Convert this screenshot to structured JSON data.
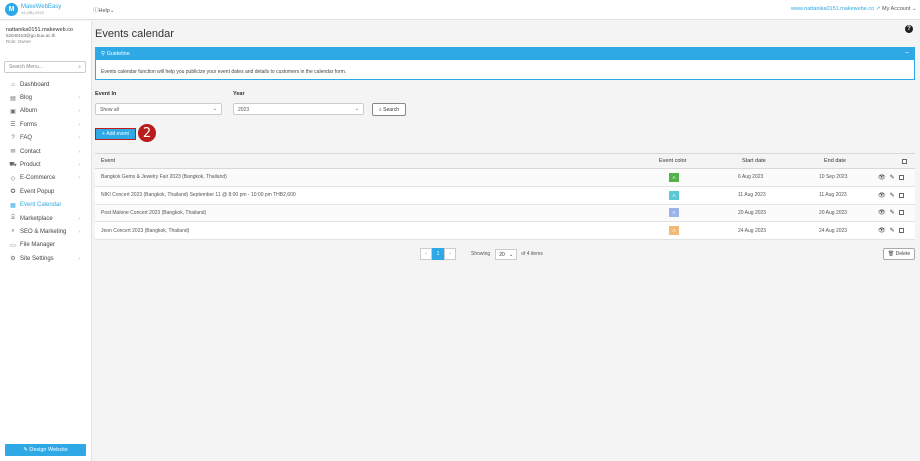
{
  "topbar": {
    "logo_mark": "M",
    "brand_name": "MakeWebEasy",
    "brand_version": "v4 (4B) 2023",
    "help_label": "Help",
    "site_link": "www.nattanika0151.makewebe.co",
    "account_label": "My Account"
  },
  "user": {
    "name": "nattanika0151.makeweb.co",
    "email": "62040153@go.buu.ac.th",
    "role": "Role: Owner"
  },
  "sidebar": {
    "search_placeholder": "Search Menu...",
    "items": [
      {
        "label": "Dashboard",
        "icon": "home-icon",
        "glyph": "⌂",
        "chevron": false
      },
      {
        "label": "Blog",
        "icon": "blog-icon",
        "glyph": "▤",
        "chevron": true
      },
      {
        "label": "Album",
        "icon": "album-icon",
        "glyph": "▣",
        "chevron": true
      },
      {
        "label": "Forms",
        "icon": "forms-icon",
        "glyph": "☰",
        "chevron": true
      },
      {
        "label": "FAQ",
        "icon": "faq-icon",
        "glyph": "?",
        "chevron": true
      },
      {
        "label": "Contact",
        "icon": "contact-icon",
        "glyph": "✉",
        "chevron": true
      },
      {
        "label": "Product",
        "icon": "product-icon",
        "glyph": "⛟",
        "chevron": true
      },
      {
        "label": "E-Commerce",
        "icon": "tag-icon",
        "glyph": "◇",
        "chevron": true
      },
      {
        "label": "Event Popup",
        "icon": "popup-icon",
        "glyph": "✪",
        "chevron": false
      },
      {
        "label": "Event Calendar",
        "icon": "calendar-icon",
        "glyph": "▦",
        "chevron": false,
        "active": true
      },
      {
        "label": "Marketplace",
        "icon": "marketplace-icon",
        "glyph": "⌸",
        "chevron": true
      },
      {
        "label": "SEO & Marketing",
        "icon": "seo-icon",
        "glyph": "⌕",
        "chevron": true
      },
      {
        "label": "File Manager",
        "icon": "folder-icon",
        "glyph": "▭",
        "chevron": false
      },
      {
        "label": "Site Settings",
        "icon": "gear-icon",
        "glyph": "⚙",
        "chevron": true
      }
    ],
    "design_button": "Design Website"
  },
  "main": {
    "title": "Events calendar",
    "guide": {
      "title": "Guideline",
      "text": "Events calendar function will help you publicize your event dates and details to customers in the calendar form."
    },
    "filters": {
      "event_in_label": "Event In",
      "event_in_value": "Show all",
      "year_label": "Year",
      "year_value": "2023",
      "search_button": "Search"
    },
    "add_event_button": "Add event",
    "step_number": "2",
    "table": {
      "headers": {
        "event": "Event",
        "color": "Event color",
        "start": "Start date",
        "end": "End date"
      },
      "rows": [
        {
          "event": "Bangkok Gems & Jewelry Fair 2023 (Bangkok, Thailand)",
          "color": "#52b34a",
          "color_letter": "A",
          "start": "6 Aug 2023",
          "end": "10 Sep 2023"
        },
        {
          "event": "NIKI Concert 2023 (Bangkok, Thailand) September 11 @ 8:00 pm - 10:00 pm THB2,600",
          "color": "#5bc8d6",
          "color_letter": "A",
          "start": "11 Aug 2023",
          "end": "11 Aug 2023"
        },
        {
          "event": "Post Malone Concert 2023 (Bangkok, Thailand)",
          "color": "#9ab3e8",
          "color_letter": "A",
          "start": "20 Aug 2023",
          "end": "20 Aug 2023"
        },
        {
          "event": "Jeon Concert 2023 (Bangkok, Thailand)",
          "color": "#f2b978",
          "color_letter": "A",
          "start": "24 Aug 2023",
          "end": "24 Aug 2023"
        }
      ]
    },
    "pager": {
      "prev": "‹",
      "current": "1",
      "next": "›",
      "showing_label": "Showing",
      "per_page": "20",
      "of_items": "of 4 items"
    },
    "delete_button": "Delete"
  }
}
